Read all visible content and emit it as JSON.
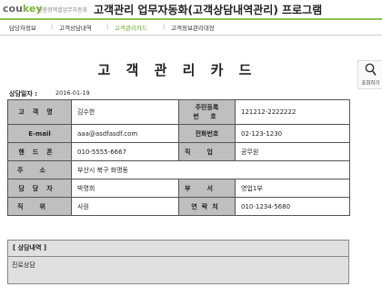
{
  "header": {
    "logo": "coukey",
    "logo_sub": "맞춤형엑셀업무자동화",
    "title": "고객관리 업무자동화(고객상담내역관리) 프로그램"
  },
  "tabs": [
    {
      "label": "담당자정보"
    },
    {
      "label": "고객상담내역"
    },
    {
      "label": "고객관리카드"
    },
    {
      "label": "고객정보관리대장"
    }
  ],
  "card": {
    "title": "고 객 관 리 카 드",
    "date_label": "상담일자 :",
    "date_value": "2016-01-19"
  },
  "search_button": {
    "label": "조회하기"
  },
  "fields": {
    "name_label": "고객명",
    "name": "김수한",
    "jumin_label_1": "주민등록",
    "jumin_label_2": "번 호",
    "jumin": "121212-2222222",
    "email_label": "E-mail",
    "email": "aaa@asdfasdf.com",
    "phone_label": "전화번호",
    "phone": "02-123-1230",
    "mobile_label": "핸드폰",
    "mobile": "010-5555-6667",
    "job_label": "직업",
    "job": "공무원",
    "address_label": "주소",
    "address": "부산시 북구 화명동",
    "manager_label": "담당자",
    "manager": "박명희",
    "dept_label": "부서",
    "dept": "영업1부",
    "position_label": "직위",
    "position": "사원",
    "contact_label": "연락처",
    "contact": "010-1234-5680"
  },
  "consult": {
    "header": "[ 상담내역 ]",
    "content": "진로상담"
  }
}
